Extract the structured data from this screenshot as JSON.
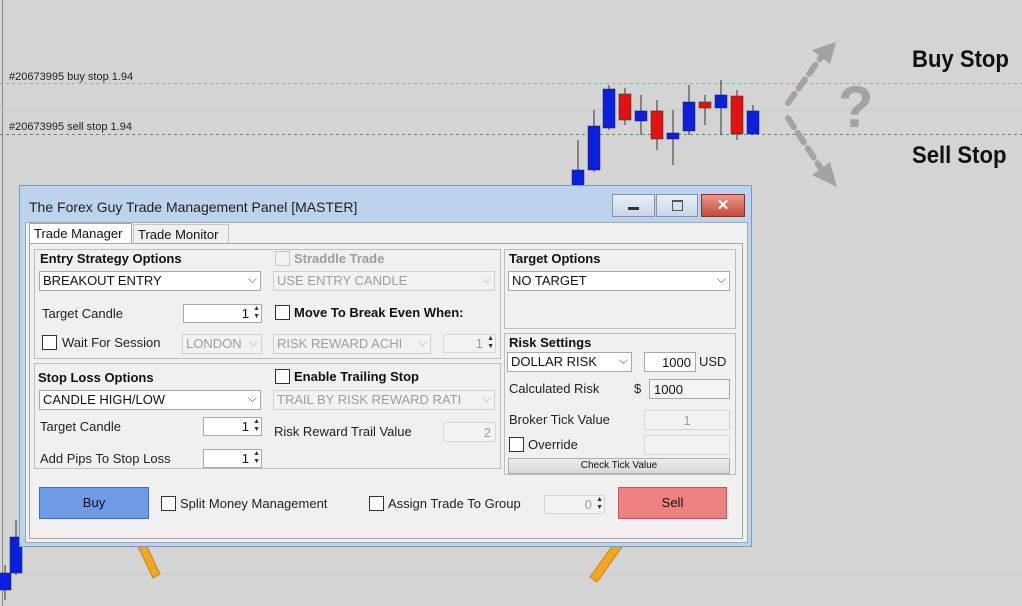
{
  "chart": {
    "buy_order_label": "#20673995 buy stop 1.94",
    "sell_order_label": "#20673995 sell stop 1.94",
    "buy_stop_text": "Buy Stop",
    "sell_stop_text": "Sell Stop",
    "question_glyph": "?",
    "bull_color": "#0a1fe0",
    "bear_color": "#e21212",
    "buy_line_color": "#e69063",
    "sell_line_color": "#4a9a5a",
    "arrow_color": "#a3a3a3",
    "pointer_color": "#f0a623"
  },
  "window": {
    "title": "The Forex Guy Trade Management Panel [MASTER]",
    "tabs": [
      "Trade Manager",
      "Trade Monitor"
    ]
  },
  "entry": {
    "heading": "Entry Strategy Options",
    "strategy": "BREAKOUT ENTRY",
    "target_candle_label": "Target Candle",
    "target_candle_value": "1",
    "wait_session_label": "Wait For Session",
    "session_value": "LONDON"
  },
  "straddle": {
    "label": "Straddle Trade",
    "candle_value": "USE ENTRY CANDLE"
  },
  "breakeven": {
    "label": "Move To Break Even When:",
    "mode_value": "RISK REWARD ACHI",
    "value": "1"
  },
  "target": {
    "heading": "Target Options",
    "value": "NO TARGET"
  },
  "risk": {
    "heading": "Risk Settings",
    "mode_value": "DOLLAR RISK",
    "amount": "1000",
    "currency": "USD",
    "calculated_label": "Calculated Risk",
    "calculated_symbol": "$",
    "calculated_value": "1000",
    "tick_value_label": "Broker Tick Value",
    "tick_value": "1",
    "override_label": "Override",
    "check_tick_button": "Check Tick Value"
  },
  "stoploss": {
    "heading": "Stop Loss Options",
    "mode_value": "CANDLE HIGH/LOW",
    "target_candle_label": "Target Candle",
    "target_candle_value": "1",
    "add_pips_label": "Add Pips To Stop Loss",
    "add_pips_value": "1"
  },
  "trailing": {
    "label": "Enable Trailing Stop",
    "mode_value": "TRAIL BY RISK REWARD RATI",
    "trail_value_label": "Risk Reward Trail Value",
    "trail_value": "2"
  },
  "bottom": {
    "buy_label": "Buy",
    "sell_label": "Sell",
    "split_label": "Split Money Management",
    "assign_label": "Assign Trade To Group",
    "group_value": "0",
    "buy_color": "#6f9ae8",
    "sell_color": "#ee8080"
  }
}
